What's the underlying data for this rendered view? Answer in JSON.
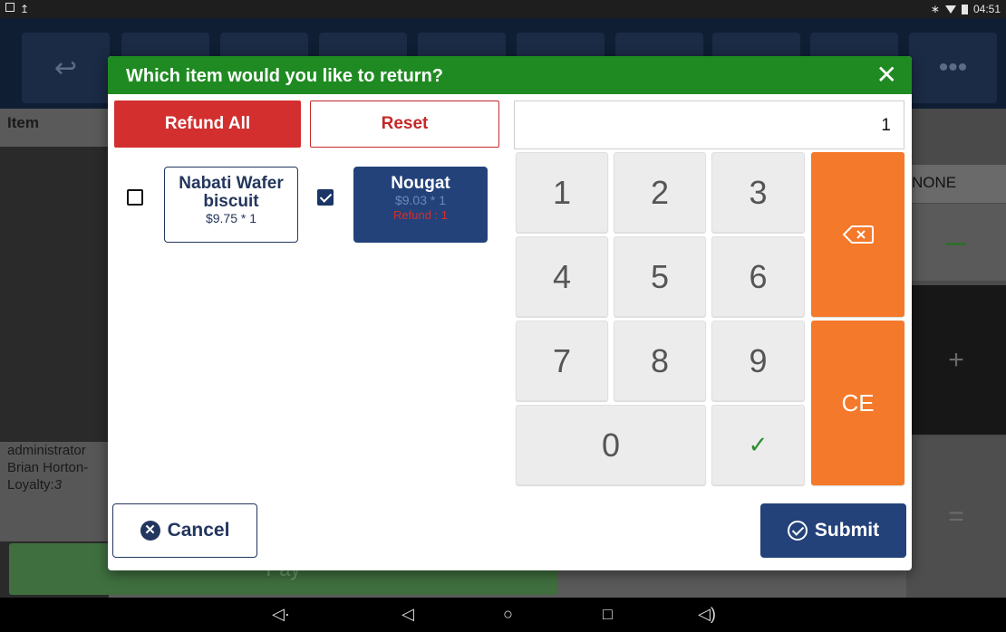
{
  "status_bar": {
    "time": "04:51"
  },
  "background": {
    "column_header": "Item",
    "dropdown_value": "NONE",
    "user_line1": "administrator",
    "user_line2": "Brian Horton-",
    "loyalty_label": "Loyalty:",
    "loyalty_value": "3",
    "pay_label": "Pay"
  },
  "dialog": {
    "title": "Which item would you like to return?",
    "refund_all_label": "Refund All",
    "reset_label": "Reset",
    "display_value": "1",
    "items": [
      {
        "name": "Nabati Wafer biscuit",
        "price_qty": "$9.75 * 1",
        "checked": false,
        "refund_text": ""
      },
      {
        "name": "Nougat",
        "price_qty": "$9.03 * 1",
        "checked": true,
        "refund_text": "Refund : 1"
      }
    ],
    "keypad": {
      "digits": [
        "1",
        "2",
        "3",
        "4",
        "5",
        "6",
        "7",
        "8",
        "9",
        "0"
      ],
      "ce_label": "CE"
    },
    "cancel_label": "Cancel",
    "submit_label": "Submit"
  },
  "colors": {
    "header_green": "#1f8a21",
    "refund_red": "#d32f2f",
    "navy": "#23427a",
    "orange": "#f5792a"
  }
}
